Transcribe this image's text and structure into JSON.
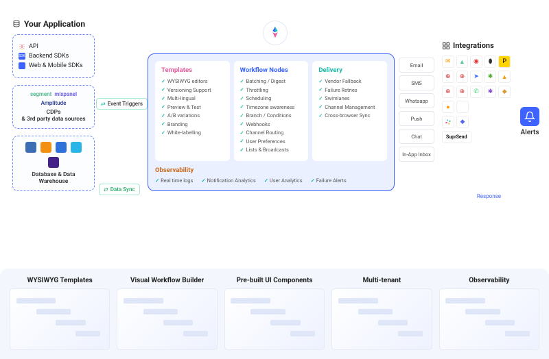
{
  "app": {
    "title": "Your Application",
    "sdks": [
      "API",
      "Backend SDKs",
      "Web & Mobile SDKs"
    ],
    "cdp": {
      "logos": [
        "segment",
        "mixpanel",
        "Amplitude"
      ],
      "label": "CDPs\n& 3rd party data sources"
    },
    "db": {
      "label": "Database & Data\nWarehouse"
    }
  },
  "pills": {
    "triggers": "Event Triggers",
    "sync": "Data Sync",
    "response": "Response"
  },
  "center": {
    "templates": {
      "title": "Templates",
      "items": [
        "WYSIWYG editors",
        "Versioning Support",
        "Multi-lingual",
        "Preview & Test",
        "A/B variations",
        "Branding",
        "White-labelling"
      ]
    },
    "workflow": {
      "title": "Workflow Nodes",
      "items": [
        "Batching / Digest",
        "Throttling",
        "Scheduling",
        "Timezone awareness",
        "Branch / Conditions",
        "Webhooks",
        "Channel Routing",
        "User Preferences",
        "Lists & Broadcasts"
      ]
    },
    "delivery": {
      "title": "Delivery",
      "items": [
        "Vendor Fallback",
        "Failure Retries",
        "Swimlanes",
        "Channel Management",
        "Cross-browser Sync"
      ]
    },
    "observability": {
      "title": "Observability",
      "items": [
        "Real time logs",
        "Notification Analytics",
        "User Analytics",
        "Failure Alerts"
      ]
    }
  },
  "channels": [
    "Email",
    "SMS",
    "Whatsapp",
    "Push",
    "Chat",
    "In-App Inbox"
  ],
  "integrations": {
    "title": "Integrations",
    "suprsend": "SuprSend"
  },
  "alerts": {
    "label": "Alerts"
  },
  "features": [
    "WYSIWYG Templates",
    "Visual Workflow Builder",
    "Pre-built UI Components",
    "Multi-tenant",
    "Observability"
  ]
}
